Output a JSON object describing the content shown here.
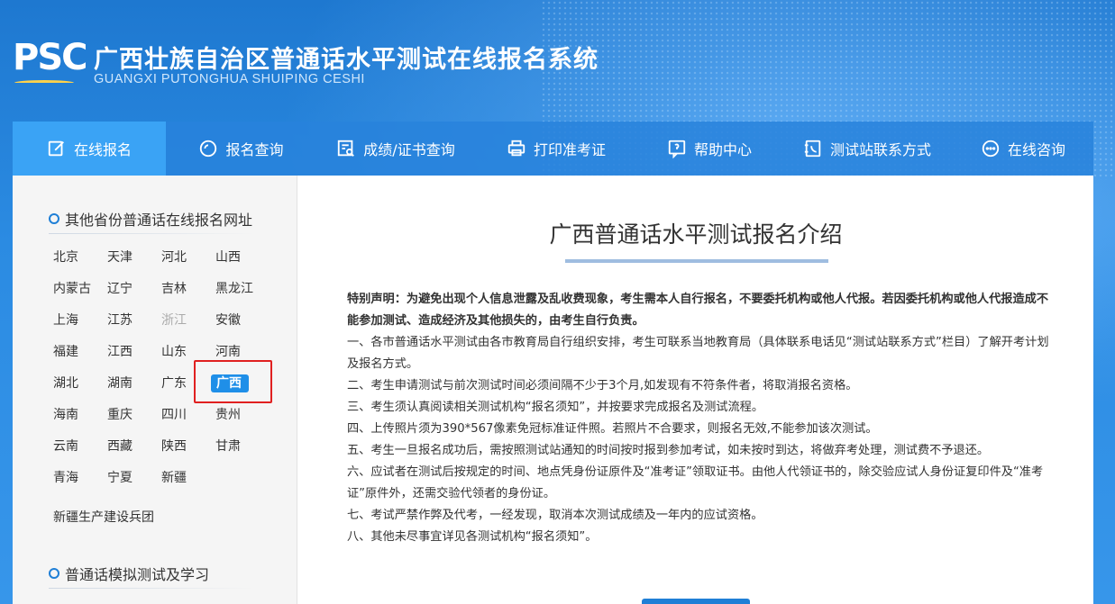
{
  "header": {
    "logo_text": "PSC",
    "title": "广西壮族自治区普通话水平测试在线报名系统",
    "subtitle": "GUANGXI PUTONGHUA SHUIPING CESHI"
  },
  "nav": {
    "items": [
      {
        "label": "在线报名",
        "icon": "edit-icon"
      },
      {
        "label": "报名查询",
        "icon": "search-circle-icon"
      },
      {
        "label": "成绩/证书查询",
        "icon": "certificate-search-icon"
      },
      {
        "label": "打印准考证",
        "icon": "printer-icon"
      },
      {
        "label": "帮助中心",
        "icon": "help-icon"
      },
      {
        "label": "测试站联系方式",
        "icon": "phone-book-icon"
      },
      {
        "label": "在线咨询",
        "icon": "chat-icon"
      }
    ]
  },
  "sidebar": {
    "section1_title": "其他省份普通话在线报名网址",
    "provinces": [
      "北京",
      "天津",
      "河北",
      "山西",
      "内蒙古",
      "辽宁",
      "吉林",
      "黑龙江",
      "上海",
      "江苏",
      "浙江",
      "安徽",
      "福建",
      "江西",
      "山东",
      "河南",
      "湖北",
      "湖南",
      "广东",
      "广西",
      "海南",
      "重庆",
      "四川",
      "贵州",
      "云南",
      "西藏",
      "陕西",
      "甘肃",
      "青海",
      "宁夏",
      "新疆"
    ],
    "extra": "新疆生产建设兵团",
    "section2_title": "普通话模拟测试及学习"
  },
  "main": {
    "title": "广西普通话水平测试报名介绍",
    "special": "特别声明：为避免出现个人信息泄露及乱收费现象，考生需本人自行报名，不要委托机构或他人代报。若因委托机构或他人代报造成不能参加测试、造成经济及其他损失的，由考生自行负责。",
    "items": [
      "一、各市普通话水平测试由各市教育局自行组织安排，考生可联系当地教育局（具体联系电话见“测试站联系方式”栏目）了解开考计划及报名方式。",
      "二、考生申请测试与前次测试时间必须间隔不少于3个月,如发现有不符条件者，将取消报名资格。",
      "三、考生须认真阅读相关测试机构“报名须知”，并按要求完成报名及测试流程。",
      "四、上传照片须为390*567像素免冠标准证件照。若照片不合要求，则报名无效,不能参加该次测试。",
      "五、考生一旦报名成功后，需按照测试站通知的时间按时报到参加考试，如未按时到达，将做弃考处理，测试费不予退还。",
      "六、应试者在测试后按规定的时间、地点凭身份证原件及“准考证”领取证书。由他人代领证书的，除交验应试人身份证复印件及“准考证”原件外，还需交验代领者的身份证。",
      "七、考试严禁作弊及代考，一经发现，取消本次测试成绩及一年内的应试资格。",
      "八、其他未尽事宜详见各测试机构“报名须知”。"
    ]
  }
}
